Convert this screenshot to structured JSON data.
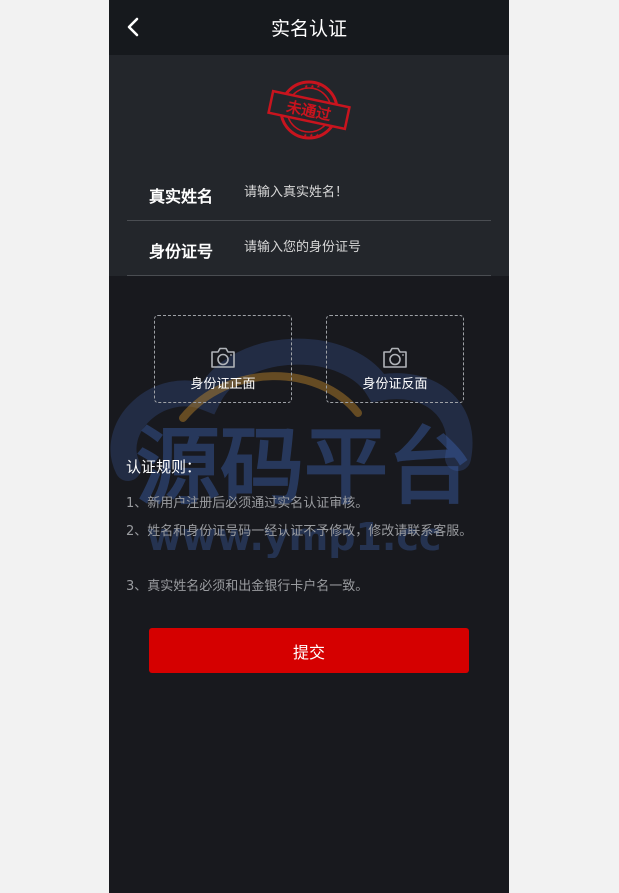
{
  "header": {
    "title": "实名认证"
  },
  "stamp": {
    "text": "未通过",
    "color": "#c8141e"
  },
  "form": {
    "fields": [
      {
        "label": "真实姓名",
        "placeholder": "请输入真实姓名！"
      },
      {
        "label": "身份证号",
        "placeholder": "请输入您的身份证号"
      }
    ]
  },
  "uploads": [
    {
      "caption": "身份证正面",
      "icon": "camera-icon"
    },
    {
      "caption": "身份证反面",
      "icon": "camera-icon"
    }
  ],
  "rules": {
    "title": "认证规则：",
    "items": [
      "1、新用户注册后必须通过实名认证审核。",
      "2、姓名和身份证号码一经认证不予修改，修改请联系客服。",
      "3、真实姓名必须和出金银行卡户名一致。"
    ]
  },
  "submit_label": "提交",
  "watermark": {
    "text": "源码平台",
    "url": "www.ymp1.cc"
  },
  "colors": {
    "accent": "#d50000",
    "page_bg": "#18191e",
    "panel_bg": "#23262b"
  }
}
